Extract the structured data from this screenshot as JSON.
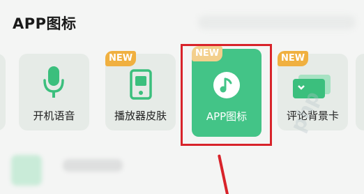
{
  "section": {
    "title": "APP图标"
  },
  "items": [
    {
      "label": "开机语音",
      "icon": "microphone-icon",
      "is_new": false
    },
    {
      "label": "播放器皮肤",
      "icon": "player-device-icon",
      "is_new": true,
      "badge": "NEW"
    },
    {
      "label": "APP图标",
      "icon": "music-note-icon",
      "is_new": true,
      "badge": "NEW",
      "selected": true
    },
    {
      "label": "评论背景卡",
      "icon": "cards-icon",
      "is_new": true,
      "badge": "NEW"
    }
  ],
  "watermark": "php",
  "colors": {
    "accent": "#43c487",
    "icon_green": "#3bbf7d",
    "badge": "#f0b040",
    "highlight": "#d8232a"
  }
}
